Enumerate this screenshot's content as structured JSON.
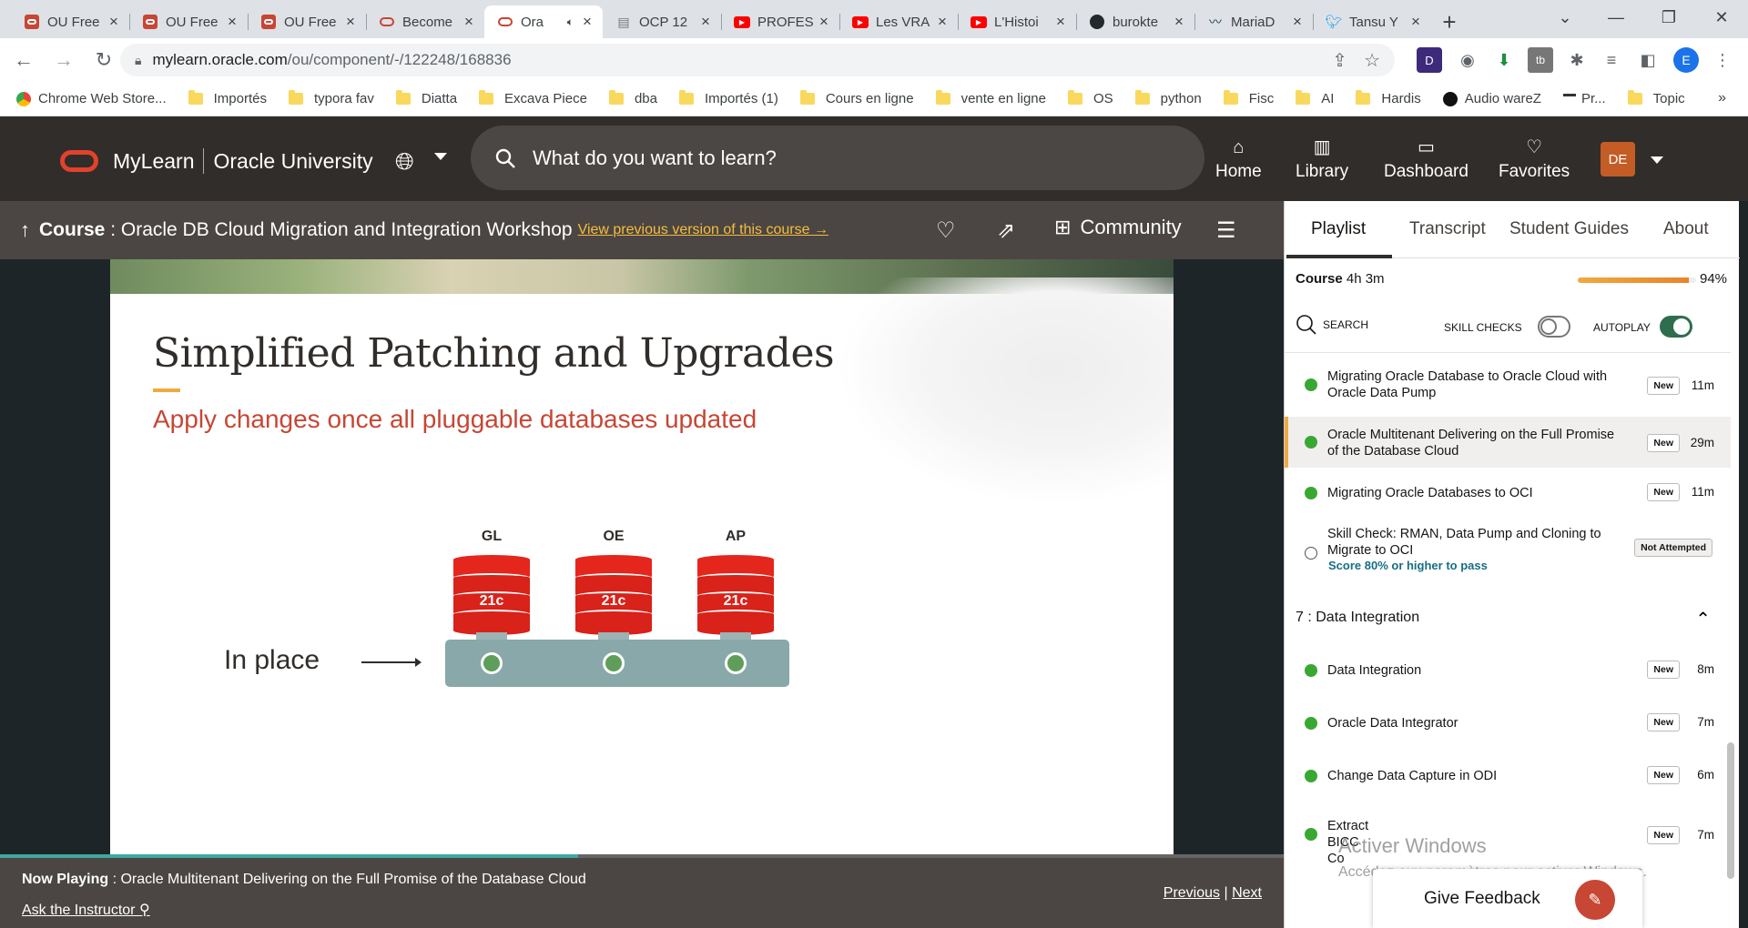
{
  "browser": {
    "tabs": [
      {
        "title": "OU Free",
        "icon": "oracle-square-icon"
      },
      {
        "title": "OU Free",
        "icon": "oracle-square-icon"
      },
      {
        "title": "OU Free",
        "icon": "oracle-square-icon"
      },
      {
        "title": "Become",
        "icon": "oracle-ring-icon"
      },
      {
        "title": "Ora",
        "icon": "oracle-ring-icon",
        "active": true,
        "audio": true
      },
      {
        "title": "OCP 12",
        "icon": "doc-icon"
      },
      {
        "title": "PROFES",
        "icon": "youtube-icon"
      },
      {
        "title": "Les VRA",
        "icon": "youtube-icon"
      },
      {
        "title": "L'Histoi",
        "icon": "youtube-icon"
      },
      {
        "title": "burokte",
        "icon": "github-icon"
      },
      {
        "title": "MariaD",
        "icon": "mariadb-icon"
      },
      {
        "title": "Tansu Y",
        "icon": "twitter-icon"
      }
    ],
    "new_tab": "+",
    "url_host": "mylearn.oracle.com",
    "url_path": "/ou/component/-/122248/168836",
    "profile_initial": "E",
    "bookmarks": [
      "Chrome Web Store...",
      "Importés",
      "typora fav",
      "Diatta",
      "Excava Piece",
      "dba",
      "Importés (1)",
      "Cours en ligne",
      "vente en ligne",
      "OS",
      "python",
      "Fisc",
      "AI",
      "Hardis",
      "Audio wareZ",
      "Pr...",
      "Topic"
    ],
    "bookmarks_more": "»"
  },
  "header": {
    "brand_left": "MyLearn",
    "brand_right": "Oracle University",
    "search_placeholder": "What do you want to learn?",
    "nav": [
      {
        "label": "Home",
        "icon": "home-icon"
      },
      {
        "label": "Library",
        "icon": "library-icon"
      },
      {
        "label": "Dashboard",
        "icon": "dashboard-icon"
      },
      {
        "label": "Favorites",
        "icon": "heart-icon"
      }
    ],
    "avatar_initials": "DE"
  },
  "course_bar": {
    "prefix": "Course",
    "title": " : Oracle DB Cloud Migration and Integration Workshop",
    "previous_version_link": "View previous version of this course",
    "community_label": "Community"
  },
  "slide": {
    "title": "Simplified Patching and Upgrades",
    "subtitle": "Apply changes once all pluggable databases updated",
    "databases": [
      {
        "label": "GL",
        "version": "21c"
      },
      {
        "label": "OE",
        "version": "21c"
      },
      {
        "label": "AP",
        "version": "21c"
      }
    ],
    "in_place_label": "In place",
    "colors": {
      "accent_red": "#c74634",
      "db_red": "#e5261c",
      "platform": "#89a8a9",
      "pin": "#5f9e5a"
    }
  },
  "now_playing": {
    "prefix": "Now Playing",
    "title": " : Oracle Multitenant Delivering on the Full Promise of the Database Cloud",
    "ask": "Ask the Instructor",
    "previous": "Previous",
    "separator": "|",
    "next": "Next",
    "progress": 0.45
  },
  "panel": {
    "tabs": [
      "Playlist",
      "Transcript",
      "Student Guides",
      "About"
    ],
    "course_label": "Course",
    "course_duration": " 4h 3m",
    "progress_pct": "94%",
    "progress_value": 0.94,
    "search_label": "SEARCH",
    "skill_checks_label": "SKILL CHECKS",
    "autoplay_label": "AUTOPLAY",
    "items": [
      {
        "title": "Migrating Oracle Database to Oracle Cloud with Oracle Data Pump",
        "badge": "New",
        "duration": "11m",
        "done": true
      },
      {
        "title": "Oracle Multitenant Delivering on the Full Promise of the Database Cloud",
        "badge": "New",
        "duration": "29m",
        "done": true,
        "current": true
      },
      {
        "title": "Migrating Oracle Databases to OCI",
        "badge": "New",
        "duration": "11m",
        "done": true
      },
      {
        "title": "Skill Check: RMAN, Data Pump and Cloning to Migrate to OCI",
        "badge": "Not Attempted",
        "score": "Score 80% or higher to pass",
        "done": false
      }
    ],
    "section": {
      "title": "7 : Data Integration"
    },
    "section_items": [
      {
        "title": "Data Integration",
        "badge": "New",
        "duration": "8m"
      },
      {
        "title": "Oracle Data Integrator",
        "badge": "New",
        "duration": "7m"
      },
      {
        "title": "Change Data Capture in ODI",
        "badge": "New",
        "duration": "6m"
      },
      {
        "title": "Extract BICC Co",
        "badge": "New",
        "duration": "7m"
      }
    ]
  },
  "overlay": {
    "watermark_title": "Activer Windows",
    "watermark_text": "Accédez aux paramètres pour activer Windows.",
    "feedback_label": "Give Feedback"
  }
}
